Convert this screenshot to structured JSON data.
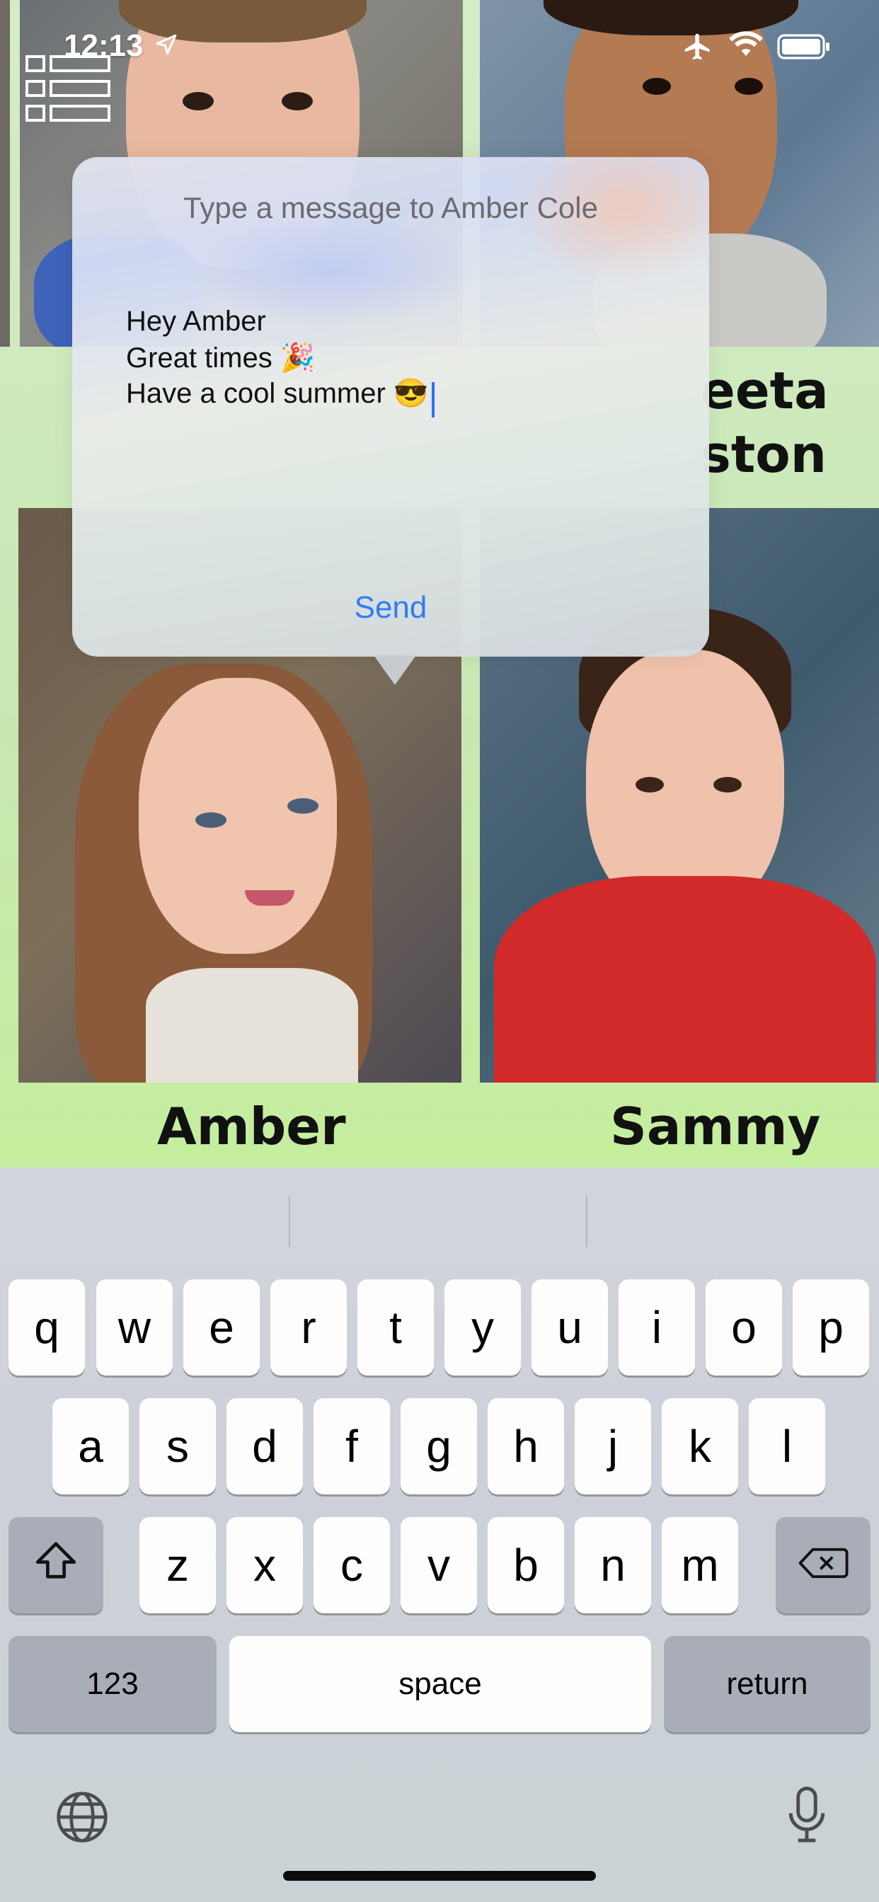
{
  "status_bar": {
    "time": "12:13"
  },
  "yearbook": {
    "names": {
      "amber": "Amber",
      "sammy": "Sammy",
      "partial_top_right_1": "eeta",
      "partial_top_right_2": "ston"
    }
  },
  "message_popup": {
    "title": "Type a message to Amber Cole",
    "lines": [
      "Hey Amber",
      "Great times 🎉",
      "Have a cool summer 😎"
    ],
    "send_label": "Send"
  },
  "keyboard": {
    "row1": [
      "q",
      "w",
      "e",
      "r",
      "t",
      "y",
      "u",
      "i",
      "o",
      "p"
    ],
    "row2": [
      "a",
      "s",
      "d",
      "f",
      "g",
      "h",
      "j",
      "k",
      "l"
    ],
    "row3": [
      "z",
      "x",
      "c",
      "v",
      "b",
      "n",
      "m"
    ],
    "numbers_label": "123",
    "space_label": "space",
    "return_label": "return"
  },
  "colors": {
    "accent": "#2f7cf6",
    "keyboard_bg": "#cfd2d9",
    "cursor": "#2f6ef6"
  }
}
